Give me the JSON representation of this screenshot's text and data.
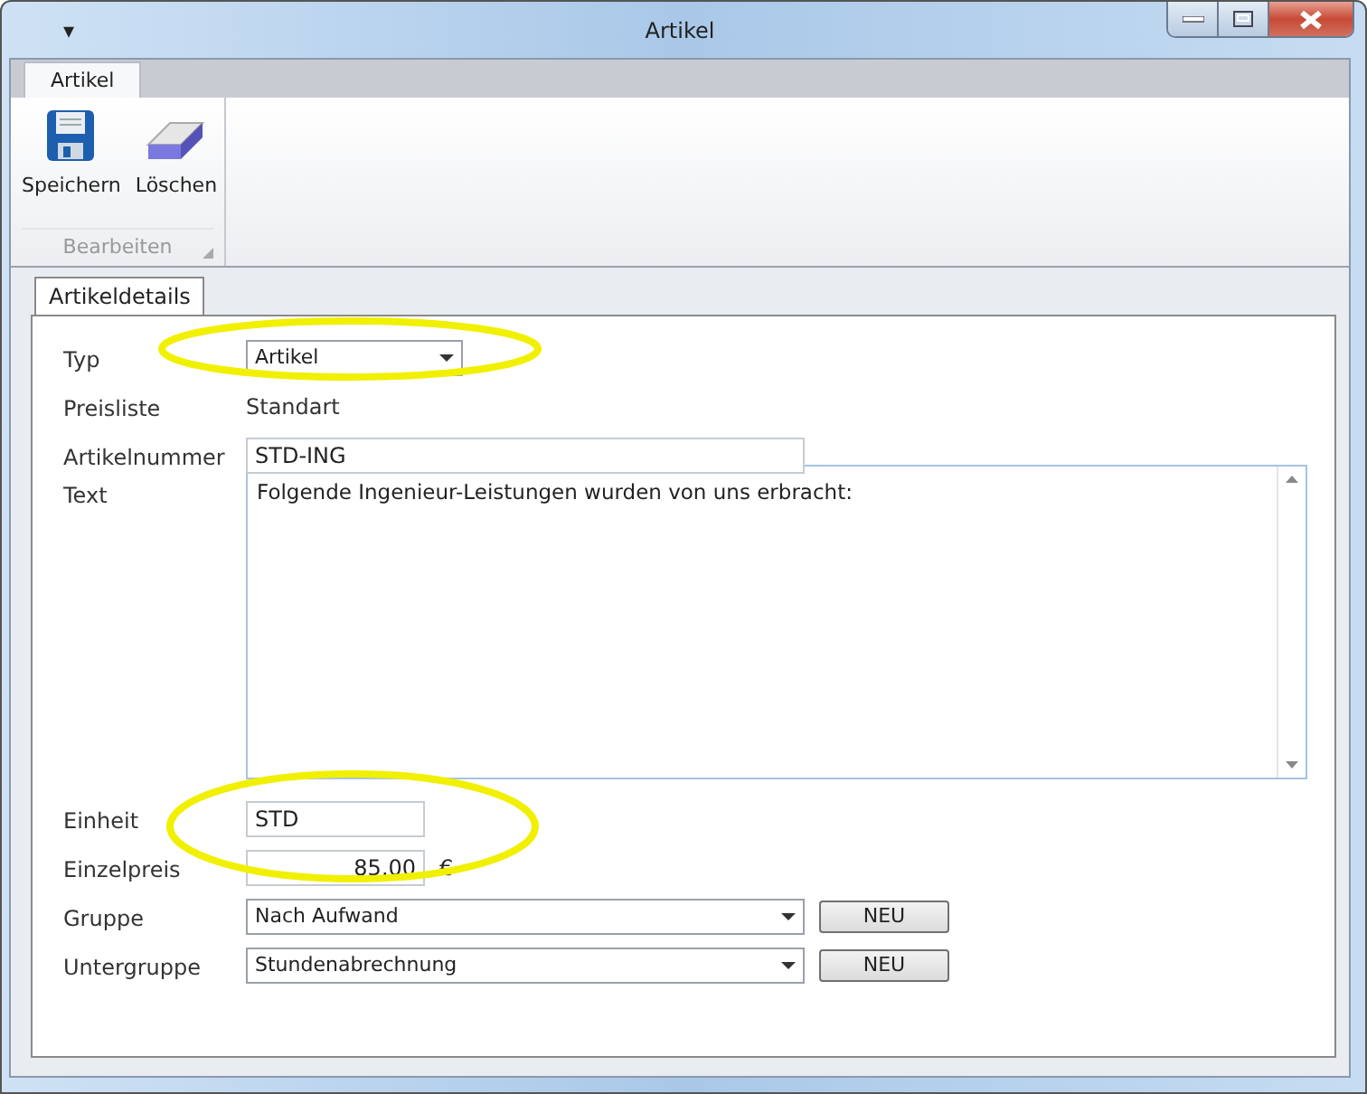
{
  "window": {
    "title": "Artikel",
    "menu_glyph": "▾"
  },
  "ribbon": {
    "tabs": [
      {
        "label": "Artikel",
        "selected": true
      }
    ],
    "buttons": [
      {
        "label": "Speichern",
        "kind": "save"
      },
      {
        "label": "Löschen",
        "kind": "erase"
      }
    ],
    "group_label": "Bearbeiten"
  },
  "detail_tabs": [
    {
      "label": "Artikeldetails",
      "selected": true
    }
  ],
  "fields": [
    {
      "label": "Typ",
      "kind": "dropdown",
      "value": "Artikel",
      "circled": true
    },
    {
      "label": "Preisliste",
      "kind": "static",
      "value": "Standart",
      "circled": false
    },
    {
      "label": "Artikelnummer",
      "kind": "input",
      "value": "STD-ING",
      "circled": false
    },
    {
      "label": "Text",
      "kind": "textarea",
      "value": "Folgende Ingenieur-Leistungen wurden von uns erbracht:",
      "circled": false
    },
    {
      "label": "Einheit",
      "kind": "input",
      "value": "STD",
      "circled": true
    },
    {
      "label": "Einzelpreis",
      "kind": "number",
      "value": "85,00",
      "unit": "€",
      "circled": true
    },
    {
      "label": "Gruppe",
      "kind": "dropdown",
      "value": "Nach Aufwand",
      "button": "NEU",
      "circled": false
    },
    {
      "label": "Untergruppe",
      "kind": "dropdown",
      "value": "Stundenabrechnung",
      "button": "NEU",
      "circled": false
    }
  ]
}
